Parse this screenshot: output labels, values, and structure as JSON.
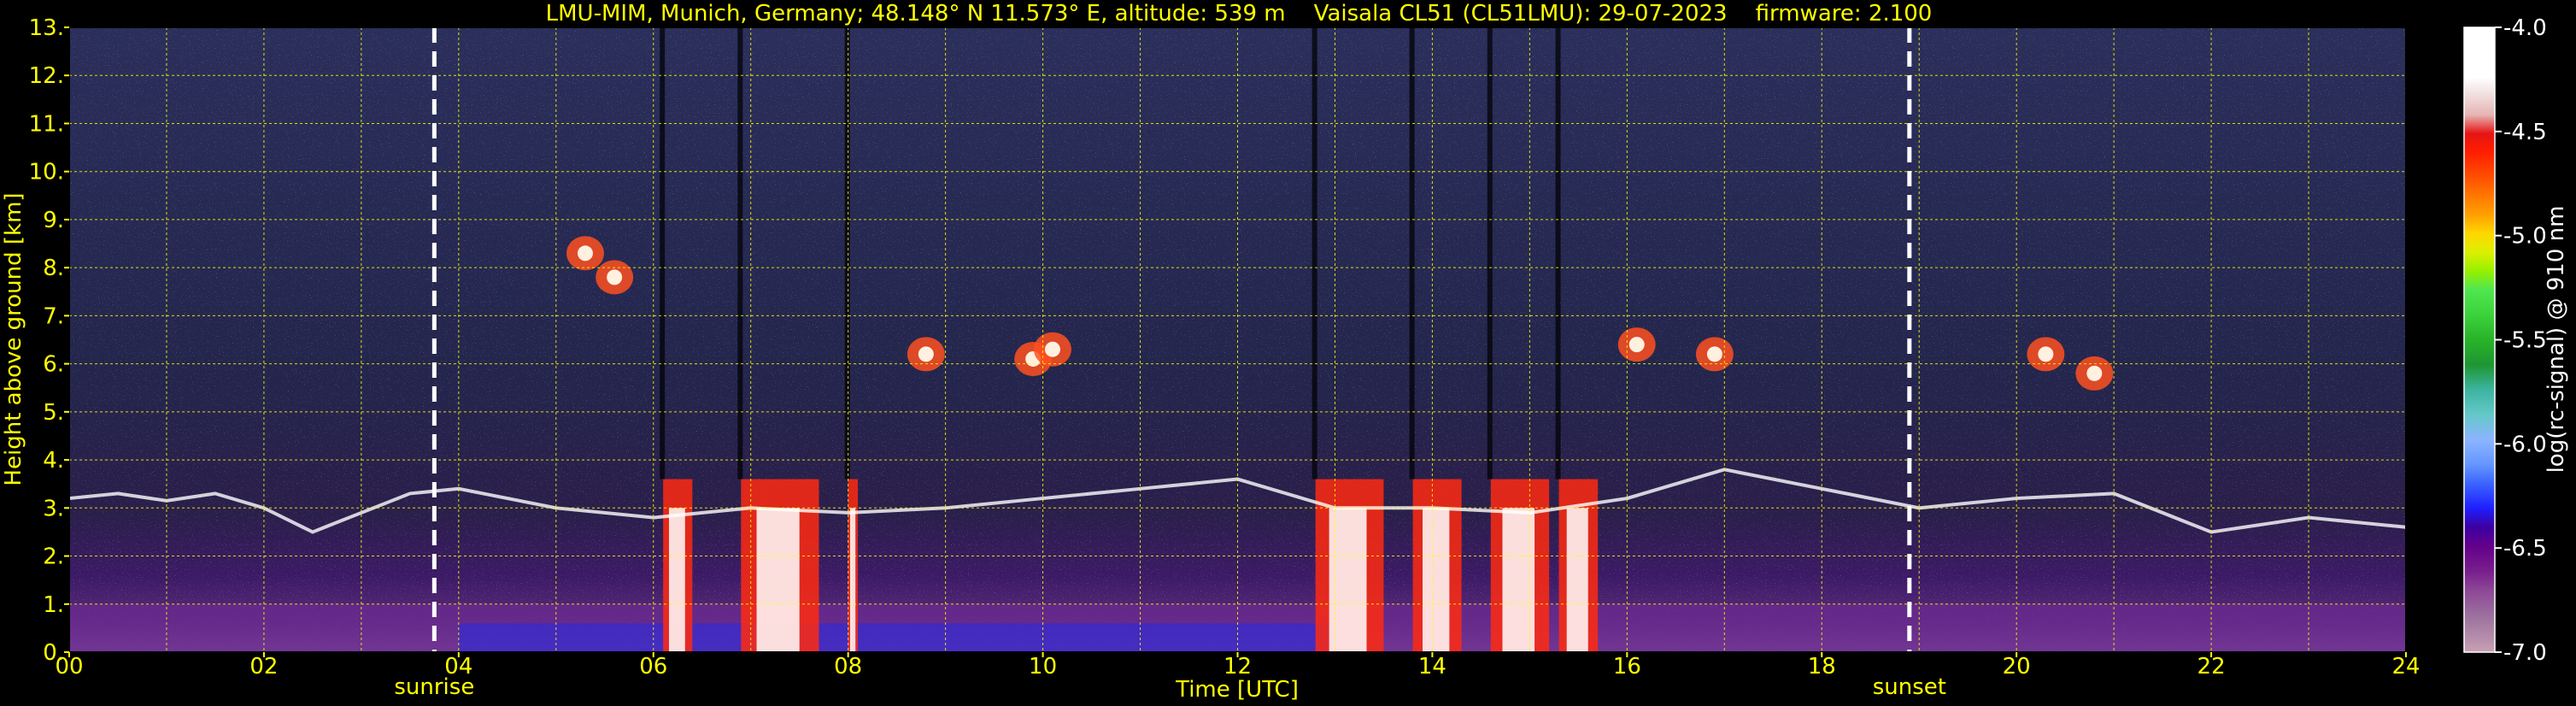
{
  "chart_data": {
    "type": "heatmap",
    "title": "LMU-MIM, Munich, Germany; 48.148° N 11.573° E, altitude: 539 m    Vaisala CL51 (CL51LMU): 29-07-2023    firmware: 2.100",
    "xlabel": "Time [UTC]",
    "ylabel": "Height above ground [km]",
    "xlim": [
      0,
      24
    ],
    "ylim": [
      0,
      13
    ],
    "x_ticks": [
      "00",
      "02",
      "04",
      "06",
      "08",
      "10",
      "12",
      "14",
      "16",
      "18",
      "20",
      "22",
      "24"
    ],
    "x_tick_values": [
      0,
      2,
      4,
      6,
      8,
      10,
      12,
      14,
      16,
      18,
      20,
      22,
      24
    ],
    "y_ticks": [
      "0.",
      "1.",
      "2.",
      "3.",
      "4.",
      "5.",
      "6.",
      "7.",
      "8.",
      "9.",
      "10.",
      "11.",
      "12.",
      "13."
    ],
    "y_tick_values": [
      0,
      1,
      2,
      3,
      4,
      5,
      6,
      7,
      8,
      9,
      10,
      11,
      12,
      13
    ],
    "grid": true,
    "events": [
      {
        "label": "sunrise",
        "x": 3.75
      },
      {
        "label": "sunset",
        "x": 18.9
      }
    ],
    "colorbar": {
      "label": "log(rc-signal) @ 910 nm",
      "range": [
        -7.0,
        -4.0
      ],
      "ticks": [
        "-4.0",
        "-4.5",
        "-5.0",
        "-5.5",
        "-6.0",
        "-6.5",
        "-7.0"
      ],
      "tick_values": [
        -4.0,
        -4.5,
        -5.0,
        -5.5,
        -6.0,
        -6.5,
        -7.0
      ],
      "colors": [
        "#c8a0b4",
        "#a078a0",
        "#8c4696",
        "#781e8c",
        "#64008c",
        "#3c00a0",
        "#1e1eff",
        "#3c64ff",
        "#6496ff",
        "#8cb4ff",
        "#64c8c8",
        "#3cb4a0",
        "#1e9632",
        "#28b428",
        "#3cd23c",
        "#50e650",
        "#96f000",
        "#dcf000",
        "#ffd700",
        "#ffa000",
        "#ff7800",
        "#ff5000",
        "#ff1e00",
        "#e61414",
        "#e6b4b4",
        "#f0dcdc",
        "#ffffff",
        "#ffffff",
        "#ffffff",
        "#ffffff"
      ]
    },
    "features": {
      "blh_layer": [
        [
          0,
          3.2
        ],
        [
          0.5,
          3.3
        ],
        [
          1,
          3.15
        ],
        [
          1.5,
          3.3
        ],
        [
          2,
          3.0
        ],
        [
          2.5,
          2.5
        ],
        [
          3,
          2.9
        ],
        [
          3.5,
          3.3
        ],
        [
          4,
          3.4
        ],
        [
          5,
          3.0
        ],
        [
          6,
          2.8
        ],
        [
          7,
          3.0
        ],
        [
          8,
          2.9
        ],
        [
          9,
          3.0
        ],
        [
          10,
          3.2
        ],
        [
          11,
          3.4
        ],
        [
          12,
          3.6
        ],
        [
          13,
          3.0
        ],
        [
          14,
          3.0
        ],
        [
          15,
          2.9
        ],
        [
          16,
          3.2
        ],
        [
          17,
          3.8
        ],
        [
          18,
          3.4
        ],
        [
          19,
          3.0
        ],
        [
          20,
          3.2
        ],
        [
          21,
          3.3
        ],
        [
          22,
          2.5
        ],
        [
          23,
          2.8
        ],
        [
          24,
          2.6
        ]
      ],
      "precip_bands": [
        [
          6.1,
          6.4
        ],
        [
          6.9,
          7.7
        ],
        [
          8.0,
          8.1
        ],
        [
          12.8,
          13.5
        ],
        [
          13.8,
          14.3
        ],
        [
          14.6,
          15.2
        ],
        [
          15.3,
          15.7
        ]
      ],
      "cloud_patches": [
        [
          5.3,
          8.3
        ],
        [
          5.6,
          7.8
        ],
        [
          8.8,
          6.2
        ],
        [
          9.9,
          6.1
        ],
        [
          10.1,
          6.3
        ],
        [
          16.1,
          6.4
        ],
        [
          16.9,
          6.2
        ],
        [
          20.3,
          6.2
        ],
        [
          20.8,
          5.8
        ]
      ]
    }
  }
}
